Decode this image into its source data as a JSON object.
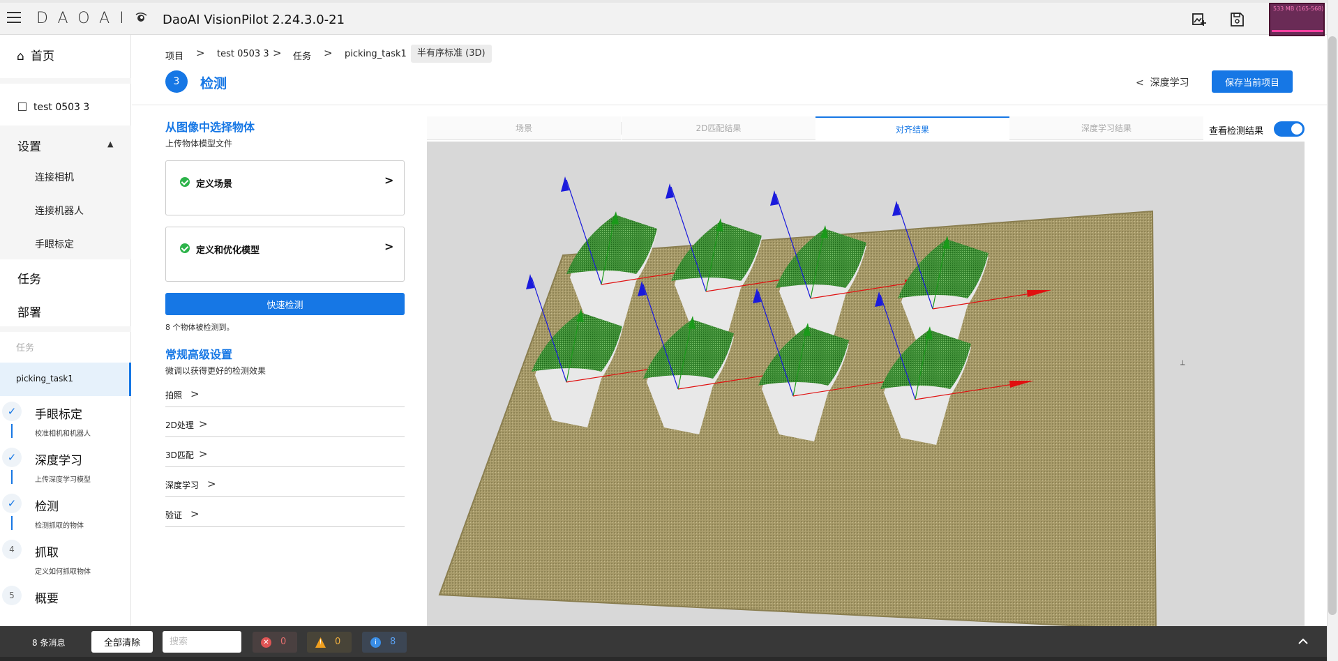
{
  "app": {
    "logo": "DAOAI",
    "title": "DaoAI VisionPilot  2.24.3.0-21",
    "memory": "533 MB (165-568)"
  },
  "sidebar": {
    "home": "首页",
    "project": "test 0503 3",
    "settings": "设置",
    "settings_items": [
      "连接相机",
      "连接机器人",
      "手眼标定"
    ],
    "tasks": "任务",
    "deploy": "部署",
    "task_section_label": "任务",
    "active_task": "picking_task1",
    "steps": [
      {
        "badge": "✓",
        "title": "手眼标定",
        "sub": "校准相机和机器人"
      },
      {
        "badge": "✓",
        "title": "深度学习",
        "sub": "上传深度学习模型"
      },
      {
        "badge": "✓",
        "title": "检测",
        "sub": "检测抓取的物体"
      },
      {
        "badge": "4",
        "title": "抓取",
        "sub": "定义如何抓取物体"
      },
      {
        "badge": "5",
        "title": "概要",
        "sub": ""
      }
    ]
  },
  "breadcrumb": {
    "items": [
      "项目",
      "test 0503 3",
      "任务",
      "picking_task1"
    ],
    "tag": "半有序标准 (3D)"
  },
  "header": {
    "step_number": "3",
    "title": "检测",
    "back_label": "深度学习",
    "save_label": "保存当前项目"
  },
  "left_panel": {
    "title": "从图像中选择物体",
    "subtitle": "上传物体模型文件",
    "cards": [
      "定义场景",
      "定义和优化模型"
    ],
    "quick_detect": "快速检测",
    "detect_info": "8 个物体被检测到。",
    "adv_title": "常规高级设置",
    "adv_subtitle": "微调以获得更好的检测效果",
    "adv_items": [
      "拍照",
      "2D处理",
      "3D匹配",
      "深度学习",
      "验证"
    ]
  },
  "view": {
    "tabs": [
      "场景",
      "2D匹配结果",
      "对齐结果",
      "深度学习结果"
    ],
    "active_tab": "对齐结果",
    "toggle_label": "查看检测结果",
    "toggle_on": true
  },
  "bottom": {
    "msg_count": "8 条消息",
    "clear": "全部清除",
    "search_placeholder": "搜索",
    "errors": "0",
    "warnings": "0",
    "infos": "8"
  },
  "colors": {
    "accent": "#1677e5",
    "error": "#e05555",
    "warning": "#f0a020",
    "info": "#3a8ee6"
  }
}
